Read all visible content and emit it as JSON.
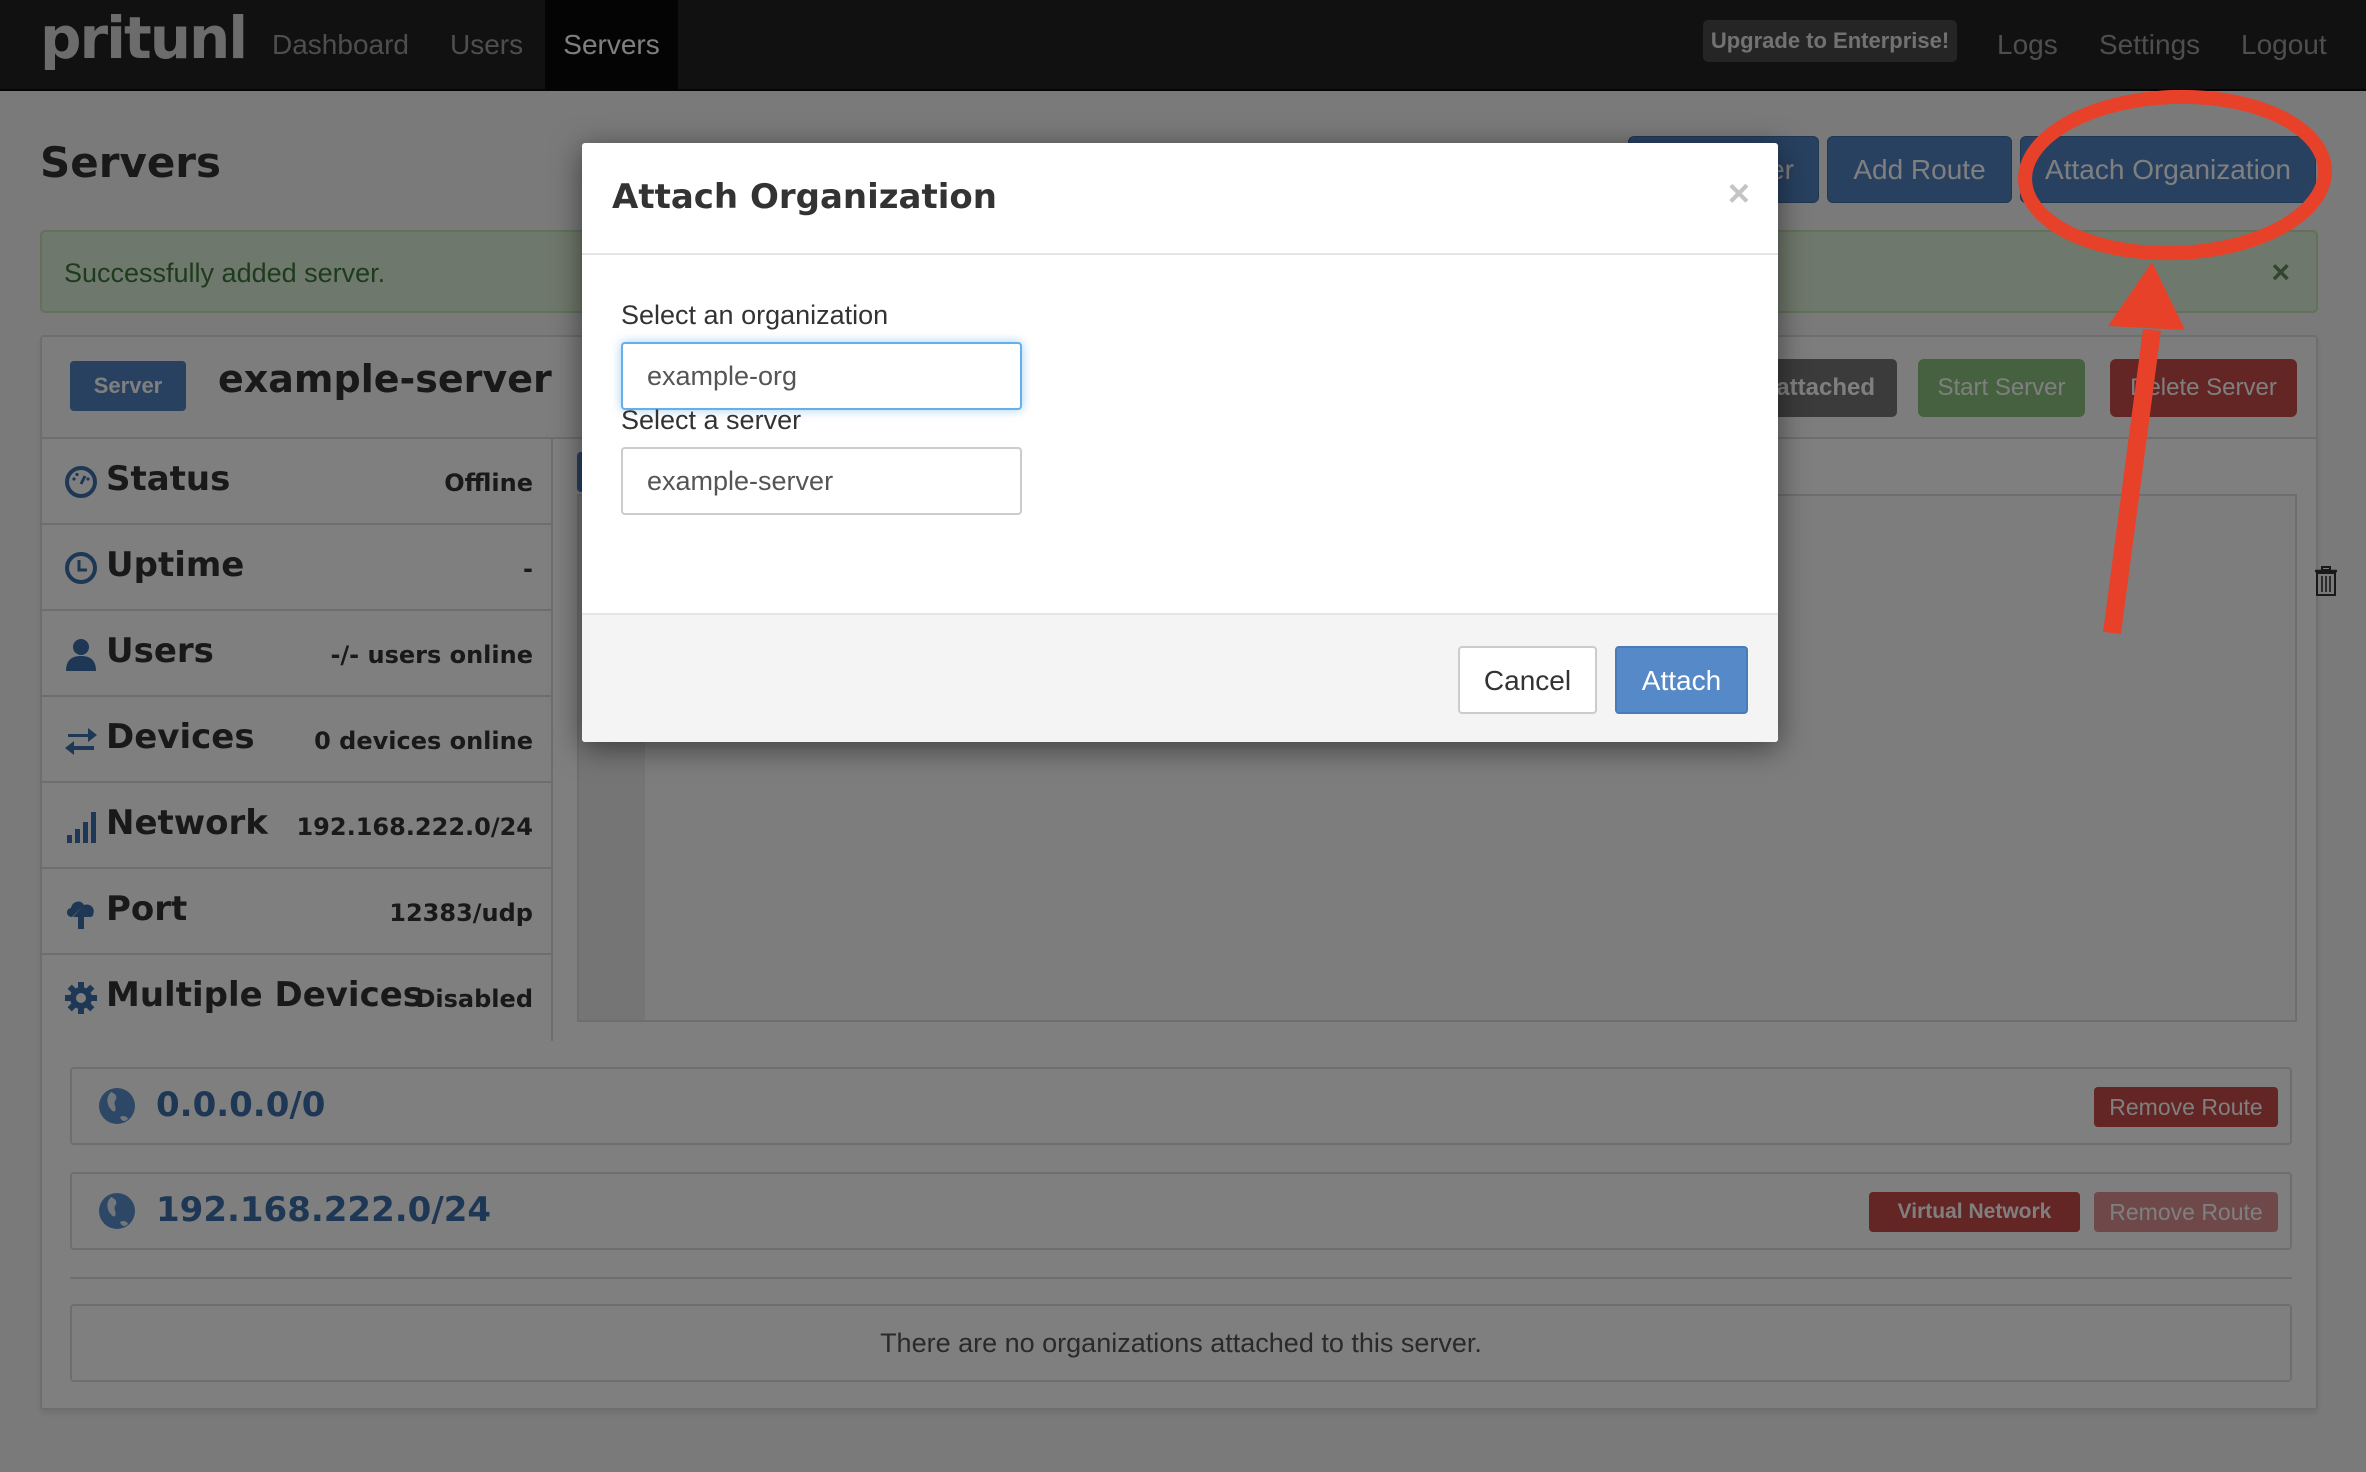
{
  "navbar": {
    "logo": "pritunl",
    "items": [
      {
        "label": "Dashboard",
        "active": false
      },
      {
        "label": "Users",
        "active": false
      },
      {
        "label": "Servers",
        "active": true
      }
    ],
    "upgrade_label": "Upgrade to Enterprise!",
    "right_items": [
      {
        "label": "Logs"
      },
      {
        "label": "Settings"
      },
      {
        "label": "Logout"
      }
    ]
  },
  "page": {
    "title": "Servers",
    "buttons": {
      "add_server": "er",
      "add_route": "Add Route",
      "attach_organization": "Attach Organization"
    }
  },
  "alert": {
    "message": "Successfully added server.",
    "close_icon": "×"
  },
  "server": {
    "badge": "Server",
    "name": "example-server",
    "org_badge": "attached",
    "start_label": "Start Server",
    "delete_label": "Delete Server",
    "stats": [
      {
        "icon": "dashboard-gauge-icon",
        "label": "Status",
        "value": "Offline"
      },
      {
        "icon": "clock-icon",
        "label": "Uptime",
        "value": "-"
      },
      {
        "icon": "user-icon",
        "label": "Users",
        "value": "-/- users online"
      },
      {
        "icon": "transfer-arrows-icon",
        "label": "Devices",
        "value": "0 devices online"
      },
      {
        "icon": "signal-bars-icon",
        "label": "Network",
        "value": "192.168.222.0/24"
      },
      {
        "icon": "cloud-upload-icon",
        "label": "Port",
        "value": "12383/udp"
      },
      {
        "icon": "gear-icon",
        "label": "Multiple Devices",
        "value": "Disabled"
      }
    ],
    "routes": [
      {
        "network": "0.0.0.0/0",
        "virtual_network": null,
        "remove_label": "Remove Route",
        "remove_disabled": false
      },
      {
        "network": "192.168.222.0/24",
        "virtual_network": "Virtual Network",
        "remove_label": "Remove Route",
        "remove_disabled": true
      }
    ],
    "organizations_empty": "There are no organizations attached to this server."
  },
  "modal": {
    "title": "Attach Organization",
    "close_icon": "×",
    "org_label": "Select an organization",
    "org_value": "example-org",
    "server_label": "Select a server",
    "server_value": "example-server",
    "cancel_label": "Cancel",
    "attach_label": "Attach"
  },
  "colors": {
    "primary": "#5082c1",
    "success": "#8cc27e",
    "danger": "#c94c4a",
    "annotation": "#e8412a"
  }
}
